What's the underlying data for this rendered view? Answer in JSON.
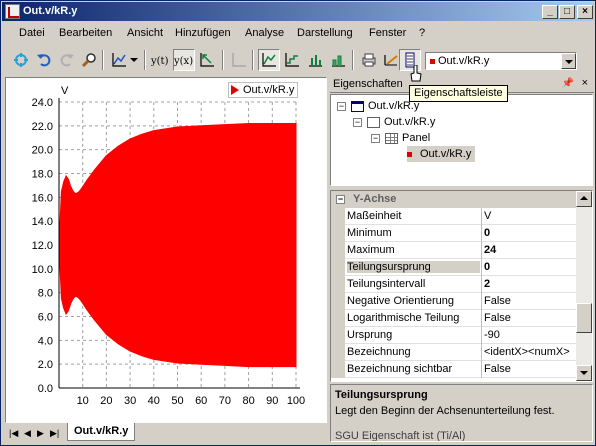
{
  "window": {
    "title": "Out.v/kR.y"
  },
  "menu": [
    "Datei",
    "Bearbeiten",
    "Ansicht",
    "Hinzufügen",
    "Analyse",
    "Darstellung",
    "Fenster",
    "?"
  ],
  "toolbar": {
    "selected_variable": "Out.v/kR.y",
    "tooltip": "Eigenschaftsleiste"
  },
  "chart_data": {
    "type": "area",
    "title": "",
    "xlabel": "",
    "ylabel": "V",
    "xlim": [
      0,
      100
    ],
    "ylim": [
      0,
      24
    ],
    "xticks": [
      10,
      20,
      30,
      40,
      50,
      60,
      70,
      80,
      90,
      100
    ],
    "yticks": [
      "0.0",
      "2.0",
      "4.0",
      "6.0",
      "8.0",
      "10.0",
      "12.0",
      "14.0",
      "16.0",
      "18.0",
      "20.0",
      "22.0",
      "24.0"
    ],
    "grid": true,
    "legend": "top-right",
    "series": [
      {
        "name": "Out.v/kR.y",
        "color": "#ff0000",
        "x": [
          0,
          1,
          2,
          3,
          4,
          5,
          6,
          7,
          8,
          9,
          10,
          12,
          15,
          20,
          25,
          30,
          35,
          40,
          50,
          60,
          70,
          80,
          90,
          100
        ],
        "upper": [
          12,
          16.5,
          17.3,
          17.8,
          17.5,
          16.9,
          16.5,
          16.3,
          16.4,
          16.6,
          16.9,
          17.5,
          18.3,
          19.5,
          20.3,
          20.9,
          21.3,
          21.6,
          21.9,
          22.0,
          22.1,
          22.2,
          22.2,
          22.2
        ],
        "lower": [
          12,
          7.5,
          6.7,
          6.2,
          6.5,
          7.1,
          7.5,
          7.7,
          7.6,
          7.4,
          7.1,
          6.5,
          5.7,
          4.5,
          3.7,
          3.1,
          2.7,
          2.4,
          2.1,
          2.0,
          1.9,
          1.8,
          1.8,
          1.8
        ]
      }
    ]
  },
  "tabs": {
    "active": "Out.v/kR.y"
  },
  "properties": {
    "header": "Eigenschaften",
    "pin": "ᵖ",
    "tree": [
      {
        "label": "Out.v/kR.y",
        "level": 0,
        "icon": "window"
      },
      {
        "label": "Out.v/kR.y",
        "level": 1,
        "icon": "page"
      },
      {
        "label": "Panel",
        "level": 2,
        "icon": "grid"
      },
      {
        "label": "Out.v/kR.y",
        "level": 3,
        "icon": "series"
      }
    ],
    "category": "Y-Achse",
    "rows": [
      {
        "name": "Maßeinheit",
        "value": "V",
        "bold": false
      },
      {
        "name": "Minimum",
        "value": "0",
        "bold": true
      },
      {
        "name": "Maximum",
        "value": "24",
        "bold": true
      },
      {
        "name": "Teilungsursprung",
        "value": "0",
        "bold": true
      },
      {
        "name": "Teilungsintervall",
        "value": "2",
        "bold": true
      },
      {
        "name": "Negative Orientierung",
        "value": "False",
        "bold": false
      },
      {
        "name": "Logarithmische Teilung",
        "value": "False",
        "bold": false
      },
      {
        "name": "Ursprung",
        "value": "-90",
        "bold": false
      },
      {
        "name": "Bezeichnung",
        "value": "<identX><numX>",
        "bold": false
      },
      {
        "name": "Bezeichnung sichtbar",
        "value": "False",
        "bold": false
      }
    ],
    "description": {
      "title": "Teilungsursprung",
      "text": "Legt den Beginn der Achsenunterteilung fest.",
      "extra": "SGU Eigenschaft ist (Ti/Al)"
    }
  }
}
